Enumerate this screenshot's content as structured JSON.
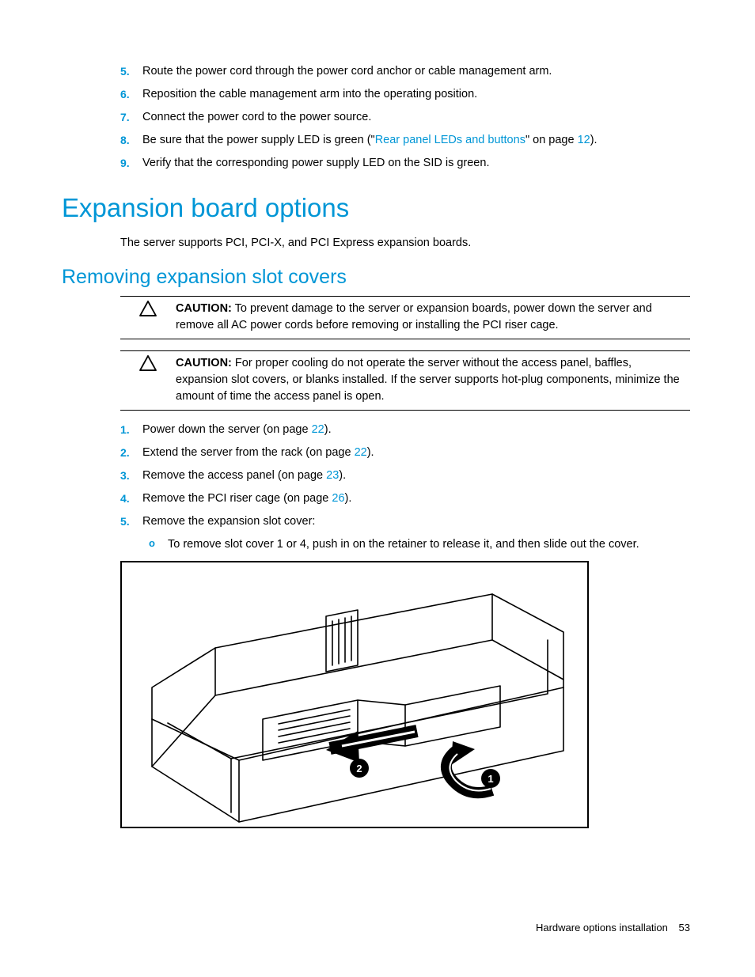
{
  "top_list": [
    {
      "num": "5.",
      "text": "Route the power cord through the power cord anchor or cable management arm."
    },
    {
      "num": "6.",
      "text": "Reposition the cable management arm into the operating position."
    },
    {
      "num": "7.",
      "text": "Connect the power cord to the power source."
    },
    {
      "num": "8.",
      "prefix": "Be sure that the power supply LED is green (\"",
      "link": "Rear panel LEDs and buttons",
      "mid": "\" on page ",
      "page": "12",
      "suffix": ")."
    },
    {
      "num": "9.",
      "text": "Verify that the corresponding power supply LED on the SID is green."
    }
  ],
  "h1": "Expansion board options",
  "intro": "The server supports PCI, PCI-X, and PCI Express expansion boards.",
  "h2": "Removing expansion slot covers",
  "caution1": {
    "label": "CAUTION:",
    "text": "  To prevent damage to the server or expansion boards, power down the server and remove all AC power cords before removing or installing the PCI riser cage."
  },
  "caution2": {
    "label": "CAUTION:",
    "text": "  For proper cooling do not operate the server without the access panel, baffles, expansion slot covers, or blanks installed. If the server supports hot-plug components, minimize the amount of time the access panel is open."
  },
  "steps": [
    {
      "num": "1.",
      "prefix": "Power down the server (on page ",
      "page": "22",
      "suffix": ")."
    },
    {
      "num": "2.",
      "prefix": "Extend the server from the rack (on page ",
      "page": "22",
      "suffix": ")."
    },
    {
      "num": "3.",
      "prefix": "Remove the access panel (on page ",
      "page": "23",
      "suffix": ")."
    },
    {
      "num": "4.",
      "prefix": "Remove the PCI riser cage (on page ",
      "page": "26",
      "suffix": ")."
    },
    {
      "num": "5.",
      "text": "Remove the expansion slot cover:"
    }
  ],
  "substep": "To remove slot cover 1 or 4, push in on the retainer to release it, and then slide out the cover.",
  "footer": {
    "section": "Hardware options installation",
    "page": "53"
  }
}
